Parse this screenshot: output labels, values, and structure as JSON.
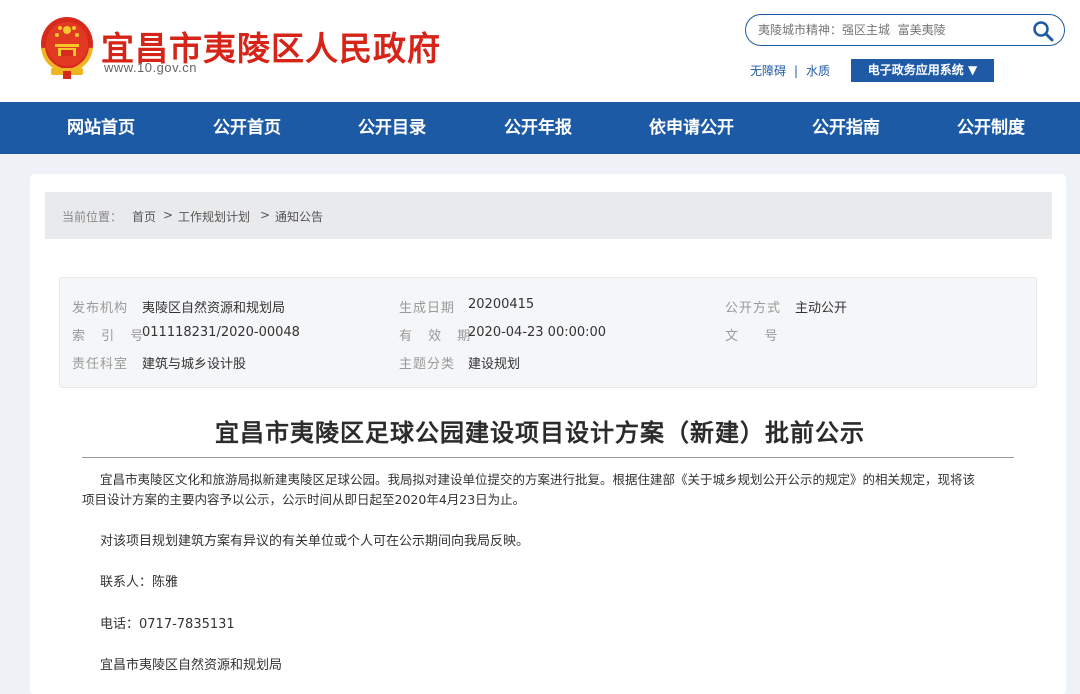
{
  "header": {
    "site_title": "宜昌市夷陵区人民政府",
    "site_url": "www.10.gov.cn",
    "search_placeholder": "夷陵城市精神：强区主城  富美夷陵",
    "util_links": [
      "无障碍",
      "水质"
    ],
    "util_separator": "|",
    "egov_button": "电子政务应用系统 ▼"
  },
  "nav": {
    "items": [
      "网站首页",
      "公开首页",
      "公开目录",
      "公开年报",
      "依申请公开",
      "公开指南",
      "公开制度"
    ]
  },
  "breadcrumb": {
    "label": "当前位置：",
    "items": [
      "首页",
      "工作规划计划",
      "通知公告"
    ],
    "separator": ">"
  },
  "meta": {
    "publisher_label": "发布机构",
    "publisher": "夷陵区自然资源和规划局",
    "gen_date_label": "生成日期",
    "gen_date": "20200415",
    "open_mode_label": "公开方式",
    "open_mode": "主动公开",
    "index_label": "索 引 号",
    "index_no": "011118231/2020-00048",
    "valid_label": "有 效 期",
    "valid_until": "2020-04-23 00:00:00",
    "doc_no_label": "文    号",
    "doc_no": "",
    "dept_label": "责任科室",
    "dept": "建筑与城乡设计股",
    "topic_label": "主题分类",
    "topic": "建设规划"
  },
  "article": {
    "title": "宜昌市夷陵区足球公园建设项目设计方案（新建）批前公示",
    "para1_line1": "宜昌市夷陵区文化和旅游局拟新建夷陵区足球公园。我局拟对建设单位提交的方案进行批复。根据住建部《关于城乡规划公开公示的规定》的相关规定，现将该",
    "para1_line2": "项目设计方案的主要内容予以公示，公示时间从即日起至2020年4月23日为止。",
    "para2": "对该项目规划建筑方案有异议的有关单位或个人可在公示期间向我局反映。",
    "contact": "联系人：陈雅",
    "phone": "电话：0717-7835131",
    "signature": "宜昌市夷陵区自然资源和规划局"
  },
  "colors": {
    "brand_red": "#d62418",
    "nav_blue": "#1d5aa5"
  }
}
